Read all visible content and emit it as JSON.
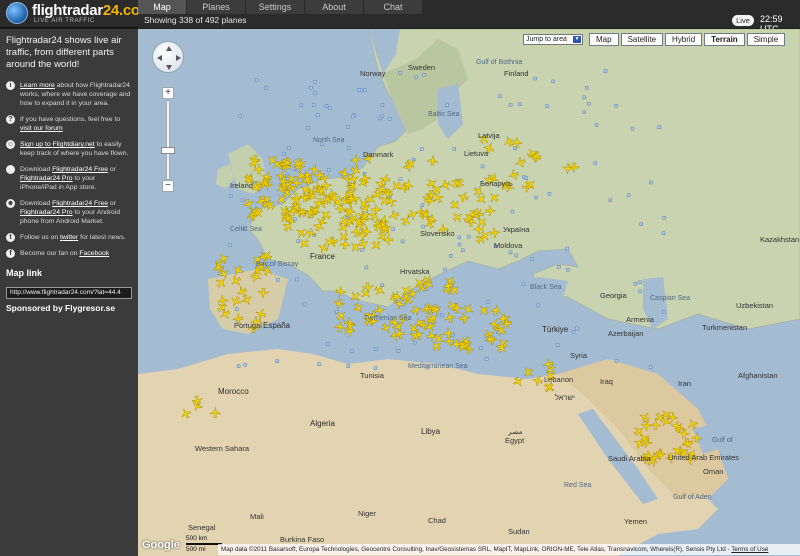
{
  "app": {
    "logo_text_main": "flightradar",
    "logo_text_suffix": "24.com",
    "logo_tagline": "LIVE AIR TRAFFIC"
  },
  "tabs": [
    {
      "label": "Map",
      "active": true
    },
    {
      "label": "Planes",
      "active": false
    },
    {
      "label": "Settings",
      "active": false
    },
    {
      "label": "About",
      "active": false
    },
    {
      "label": "Chat",
      "active": false
    }
  ],
  "status": {
    "plane_count": "Showing 338 of 492 planes",
    "live_label": "Live",
    "time": "22:59 UTC"
  },
  "sidebar": {
    "intro": "Flightradar24 shows live air traffic, from different parts around the world!",
    "items": [
      {
        "icon": "info-icon",
        "link": "Learn more",
        "text": " about how Flightradar24 works, where we have coverage and how to expand it in your area."
      },
      {
        "icon": "question-icon",
        "pre": "If you have questions, feel free to ",
        "link": "visit our forum",
        "text": ""
      },
      {
        "icon": "user-icon",
        "link": "Sign up to Flightdiary.net",
        "text": " to easily keep track of where you have flown."
      },
      {
        "icon": "apple-icon",
        "pre": "Download ",
        "link": "Flightradar24 Free",
        "mid": " or ",
        "link2": "Flightradar24 Pro",
        "text": " to your iPhone/iPad in App store."
      },
      {
        "icon": "android-icon",
        "pre": "Download ",
        "link": "Flightradar24 Free",
        "mid": " or ",
        "link2": "Flightradar24 Pro",
        "text": " to your Android phone from Android Market."
      },
      {
        "icon": "twitter-icon",
        "pre": "Follow us on ",
        "link": "twitter",
        "text": " for latest news."
      },
      {
        "icon": "facebook-icon",
        "pre": "Become our fan on ",
        "link": "Facebook",
        "text": ""
      }
    ],
    "map_link_title": "Map link",
    "map_link_value": "http://www.flightradar24.com/?lat=44.4",
    "sponsor": "Sponsored by Flygresor.se"
  },
  "map_controls": {
    "jump_to_area": "Jump to area",
    "map_types": [
      {
        "label": "Map",
        "selected": false
      },
      {
        "label": "Satellite",
        "selected": false
      },
      {
        "label": "Hybrid",
        "selected": false
      },
      {
        "label": "Terrain",
        "selected": true
      },
      {
        "label": "Simple",
        "selected": false
      }
    ],
    "zoom_in": "+",
    "zoom_out": "−"
  },
  "map_labels": {
    "sweden": "Sweden",
    "gulf_bothnia": "Gulf of Bothnia",
    "norway": "Norway",
    "finland": "Finland",
    "baltic_sea": "Baltic Sea",
    "north_sea": "North Sea",
    "latvija": "Latvija",
    "lietuva": "Lietuva",
    "belarus": "Беларусь",
    "denmark": "Danmark",
    "celtic_sea": "Celtic Sea",
    "ireland": "Ireland",
    "france": "France",
    "slovensko": "Slovensko",
    "ukraine": "Україна",
    "moldova": "Moldova",
    "bay_biscay": "Bay of Biscay",
    "hrvatska": "Hrvatska",
    "black_sea": "Black Sea",
    "espana": "España",
    "portugal": "Portugal",
    "tyrrhenian": "Tyrrhenian Sea",
    "turkiye": "Türkiye",
    "tunisia": "Tunisia",
    "mediterranean": "Mediterranean Sea",
    "syria": "Syria",
    "lebanon": "Lebanon",
    "iraq": "Iraq",
    "israel": "ישראל",
    "morocco": "Morocco",
    "algeria": "Algeria",
    "libya": "Libya",
    "egypt_ar": "مصر",
    "egypt": "Egypt",
    "western_sahara": "Western Sahara",
    "saudi": "Saudi Arabia",
    "red_sea": "Red Sea",
    "senegal": "Senegal",
    "mali": "Mali",
    "niger": "Niger",
    "chad": "Chad",
    "sudan": "Sudan",
    "yemen": "Yemen",
    "burkina": "Burkina Faso",
    "oman": "Oman",
    "uae": "United Arab Emirates",
    "gulf_aden": "Gulf of Aden",
    "gulf_of": "Gulf of",
    "afghanistan": "Afghanistan",
    "turkmenistan": "Turkmenistan",
    "uzbekistan": "Uzbekistan",
    "caspian": "Caspian Sea",
    "kazakhstan": "Kazakhstan",
    "georgia": "Georgia",
    "iran": "Iran",
    "armenia": "Armenia",
    "azerbaijan": "Azerbaijan"
  },
  "map_footer": {
    "google": "Google",
    "scale_km": "500 km",
    "scale_mi": "500 mi",
    "attribution": "Map data ©2011 Basarsoft, Europa Technologies, Geocentre Consulting, Inav/Geosistemas SRL, MapIT, MapLink, ORION-ME, Tele Atlas, Transnavicom, Whereis(R), Sensis Pty Ltd - ",
    "terms": "Terms of Use"
  },
  "colors": {
    "plane": "#f3d400",
    "marker": "#a8c8f0",
    "topbar": "#2b2b2b",
    "sidebar": "#3b3b3b",
    "logo_accent": "#f5b400"
  }
}
